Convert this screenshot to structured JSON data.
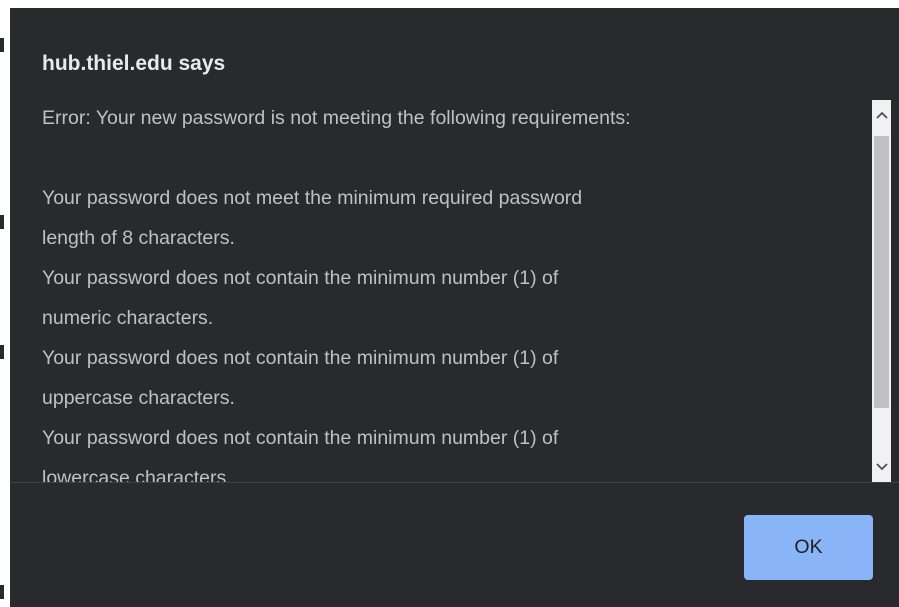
{
  "dialog": {
    "title": "hub.thiel.edu says",
    "message_lines": [
      "Error:  Your new password is not meeting the following requirements:",
      "",
      "Your password does not meet the minimum required password",
      "length of 8 characters.",
      "Your password does not contain the minimum number (1) of",
      "numeric characters.",
      "Your password does not contain the minimum number (1) of",
      "uppercase characters.",
      "Your password does not contain the minimum number (1) of",
      "lowercase characters."
    ],
    "ok_label": "OK"
  },
  "icons": {
    "scroll_up": "chevron-up-icon",
    "scroll_down": "chevron-down-icon"
  },
  "colors": {
    "dialog_background": "#292a2d",
    "title_text": "#e8eaed",
    "message_text": "#bdc1c6",
    "ok_button": "#8ab4f8",
    "scrollbar_track": "#f1f1f1",
    "scrollbar_thumb": "#c1c1c1"
  }
}
